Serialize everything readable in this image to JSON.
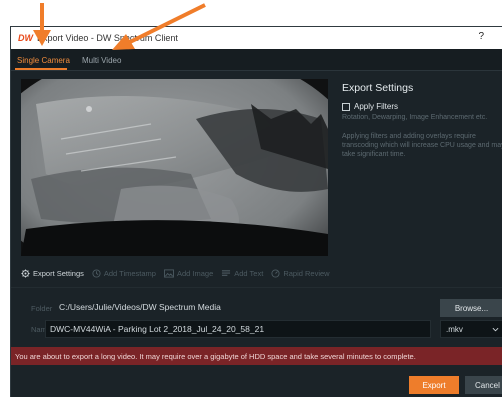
{
  "window": {
    "logo": "DW",
    "title": "Export Video - DW Spectrum Client",
    "help": "?"
  },
  "tabs": [
    {
      "label": "Single Camera",
      "active": true
    },
    {
      "label": "Multi Video",
      "active": false
    }
  ],
  "export_settings": {
    "title": "Export Settings",
    "apply_filters_label": "Apply Filters",
    "apply_filters_checked": false,
    "filters_description": "Rotation, Dewarping, Image Enhancement etc.",
    "transcoding_warning": "Applying filters and adding overlays require transcoding which will increase CPU usage and may take significant time."
  },
  "toolbar": {
    "export_settings": "Export Settings",
    "add_timestamp": "Add Timestamp",
    "add_image": "Add Image",
    "add_text": "Add Text",
    "rapid_review": "Rapid Review"
  },
  "folder": {
    "label": "Folder",
    "value": "C:/Users/Julie/Videos/DW Spectrum Media",
    "browse": "Browse..."
  },
  "name": {
    "label": "Name",
    "value": "DWC-MV44WiA - Parking Lot 2_2018_Jul_24_20_58_21",
    "format": ".mkv"
  },
  "warning": "You are about to export a long video. It may require over a gigabyte of HDD space and take several minutes to complete.",
  "buttons": {
    "export": "Export",
    "cancel": "Cancel"
  },
  "colors": {
    "accent": "#ee7d2b",
    "annotation_arrow": "#f07d2a",
    "warning_bg": "#7a2427",
    "dialog_bg": "#1b2328"
  },
  "icons": {
    "export_settings": "gear-icon",
    "add_timestamp": "clock-icon",
    "add_image": "image-icon",
    "add_text": "text-lines-icon",
    "rapid_review": "speedometer-icon",
    "format_select": "chevron-down-icon"
  }
}
